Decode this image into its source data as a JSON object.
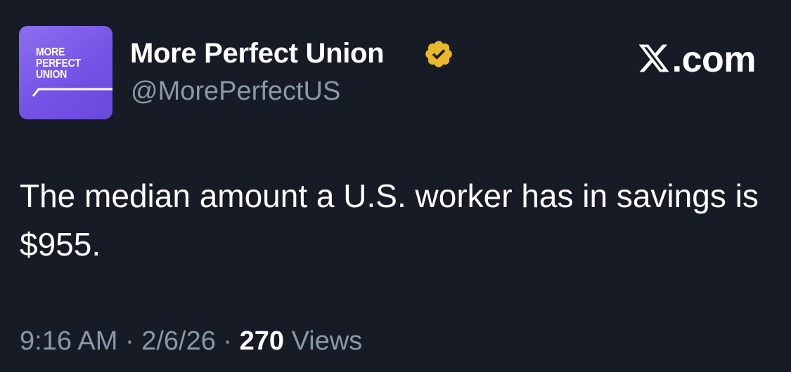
{
  "author": {
    "avatar_logo_lines": [
      "MORE",
      "PERFECT",
      "UNION"
    ],
    "display_name": "More Perfect Union",
    "handle": "@MorePerfectUS",
    "verified_badge_icon": "verified-badge-icon",
    "verified_badge_color": "#e8b829"
  },
  "brand": {
    "logo_icon": "x-logo-icon",
    "text": ".com"
  },
  "tweet": {
    "text": "The median amount a U.S. worker has in savings is $955."
  },
  "meta": {
    "time": "9:16 AM",
    "separator": " · ",
    "date": "2/6/26",
    "views_count": "270",
    "views_label": " Views"
  },
  "colors": {
    "background": "#161b26",
    "secondary_text": "#8b98a5",
    "avatar_purple": "#7553e6"
  }
}
